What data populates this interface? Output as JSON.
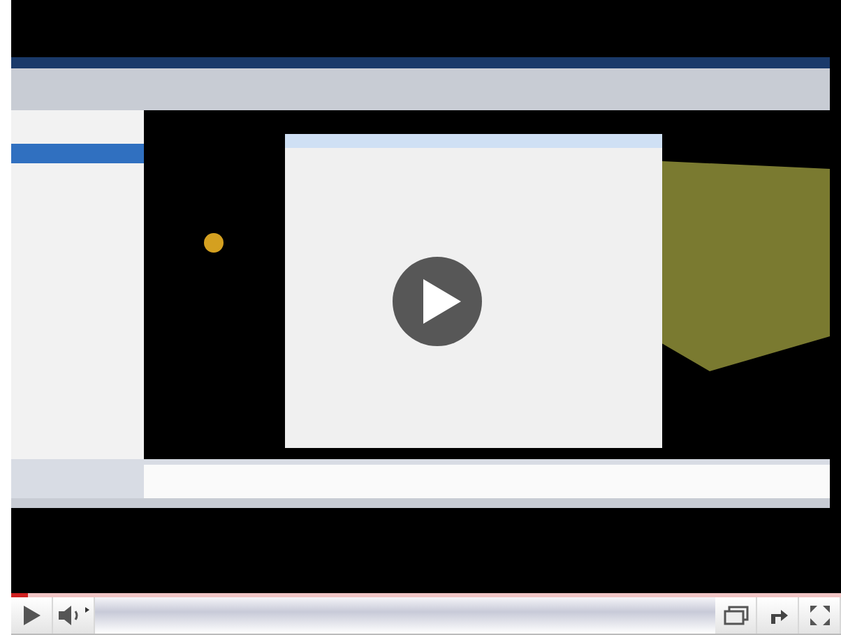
{
  "progress": {
    "level": 0.02
  }
}
